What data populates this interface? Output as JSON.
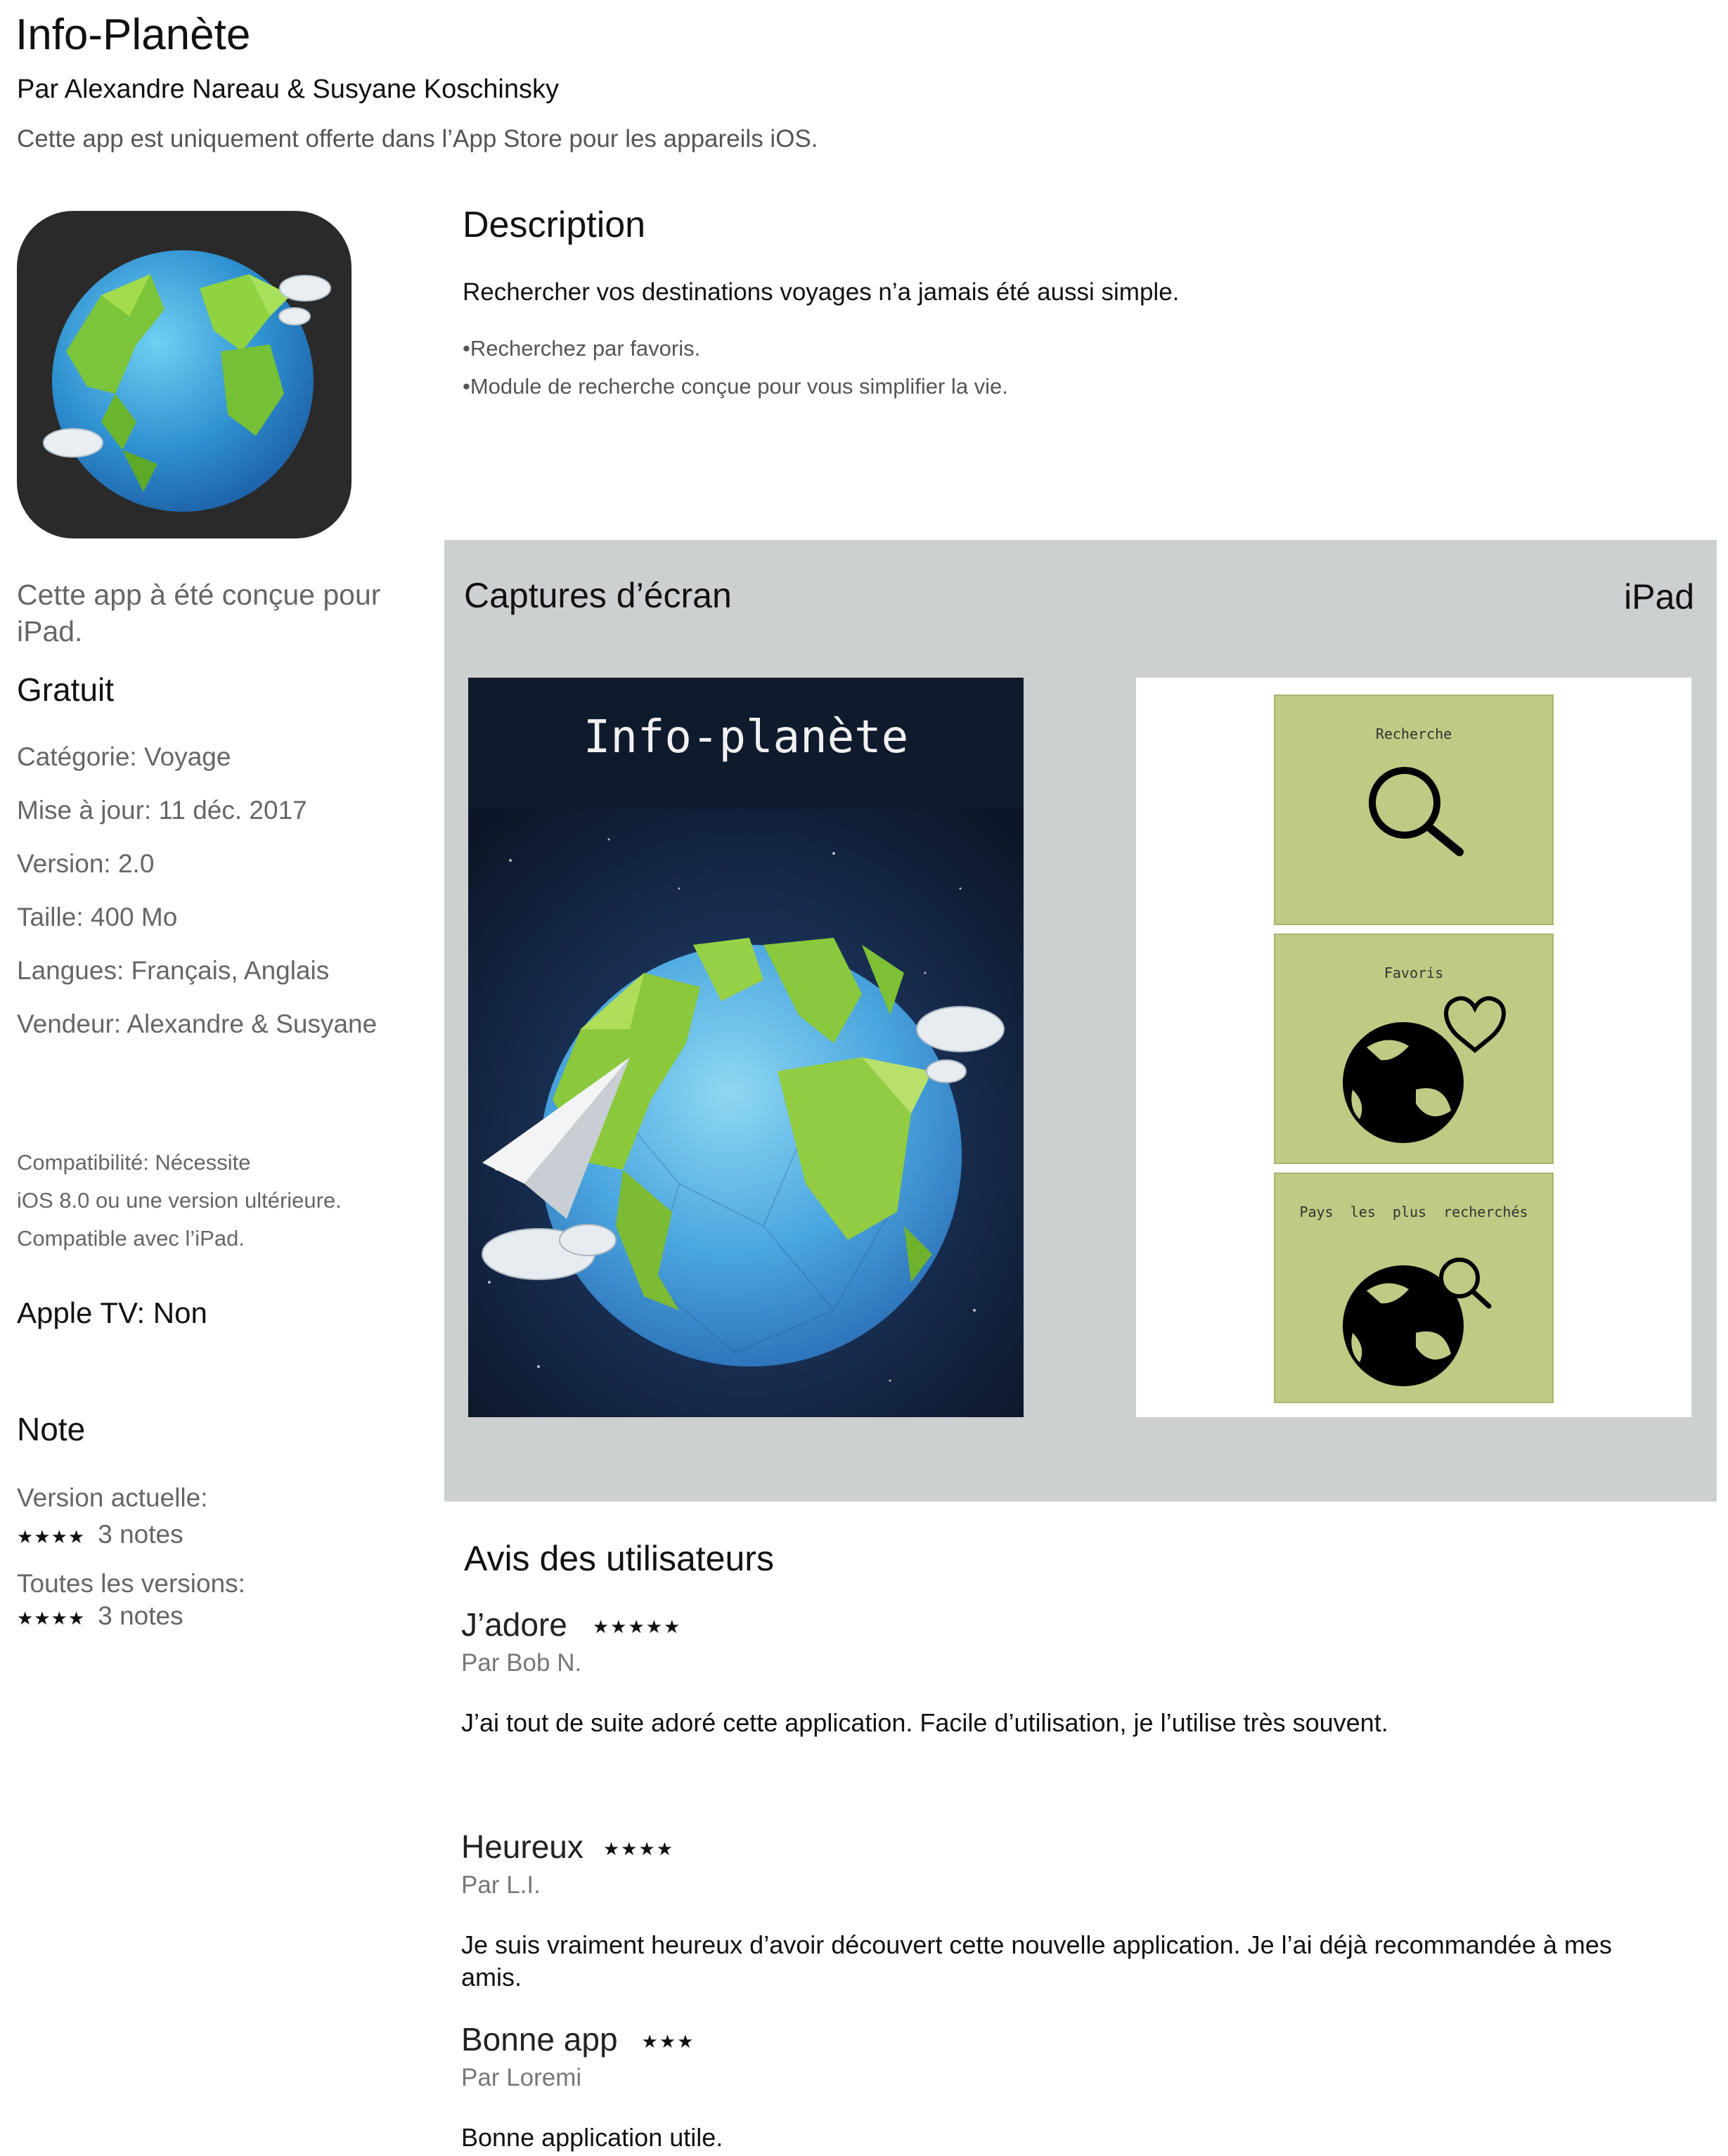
{
  "app": {
    "title": "Info-Planète",
    "authors": "Par Alexandre Nareau  & Susyane Koschinsky",
    "offer": "Cette app est uniquement offerte dans l’App Store pour les appareils iOS."
  },
  "description": {
    "title": "Description",
    "lead": "Rechercher vos destinations voyages n’a jamais été aussi simple.",
    "bullets": [
      "•Recherchez par favoris.",
      "•Module de recherche conçue pour vous simplifier la vie."
    ]
  },
  "info": {
    "designed_for": "Cette app à été conçue pour  iPad.",
    "price": "Gratuit",
    "category": "Catégorie: Voyage",
    "updated": "Mise à jour: 11 déc. 2017",
    "version": "Version: 2.0",
    "size": "Taille: 400 Mo",
    "languages": "Langues: Français, Anglais",
    "vendor": "Vendeur: Alexandre & Susyane",
    "compat_lines": [
      "Compatibilité: Nécessite",
      "iOS 8.0 ou une version ultérieure.",
      "Compatible avec l’iPad."
    ],
    "apple_tv": "Apple TV: Non"
  },
  "note": {
    "title": "Note",
    "current_label": "Version actuelle:",
    "current_stars": "★★★★",
    "current_count": "3 notes",
    "all_label": "Toutes les versions:",
    "all_stars": "★★★★",
    "all_count": "3 notes"
  },
  "screenshots": {
    "title": "Captures d’écran",
    "device": "iPad",
    "shot1_title": "Info-planète",
    "tiles": [
      "Recherche",
      "Favoris",
      "Pays  les  plus  recherchés"
    ]
  },
  "reviews": {
    "title": "Avis des utilisateurs",
    "items": [
      {
        "title": "J’adore",
        "stars": "★★★★★",
        "author": "Par Bob N.",
        "body": "J’ai tout de suite adoré cette application. Facile d’utilisation, je l’utilise très souvent."
      },
      {
        "title": "Heureux",
        "stars": "★★★★",
        "author": "Par L.I.",
        "body": "Je suis vraiment heureux d’avoir découvert cette nouvelle application. Je l’ai déjà recommandée à mes amis."
      },
      {
        "title": "Bonne app",
        "stars": "★★★",
        "author": "Par Loremi",
        "body": "Bonne application utile."
      }
    ]
  },
  "colors": {
    "panel": "#cdd0d0",
    "tile": "#bfca84",
    "icon_bg": "#2a2a2a"
  },
  "icons": [
    "globe-icon",
    "search-icon",
    "heart-icon",
    "paper-plane-icon",
    "cloud-icon"
  ]
}
